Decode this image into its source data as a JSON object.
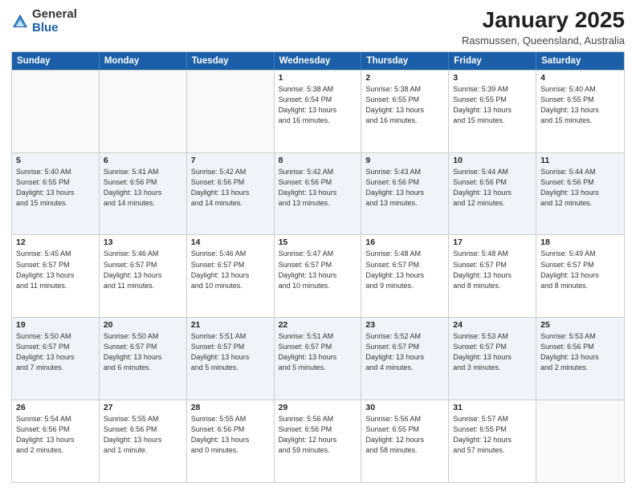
{
  "header": {
    "logo_general": "General",
    "logo_blue": "Blue",
    "month_title": "January 2025",
    "location": "Rasmussen, Queensland, Australia"
  },
  "weekdays": [
    "Sunday",
    "Monday",
    "Tuesday",
    "Wednesday",
    "Thursday",
    "Friday",
    "Saturday"
  ],
  "rows": [
    {
      "alt": false,
      "cells": [
        {
          "date": "",
          "info": ""
        },
        {
          "date": "",
          "info": ""
        },
        {
          "date": "",
          "info": ""
        },
        {
          "date": "1",
          "info": "Sunrise: 5:38 AM\nSunset: 6:54 PM\nDaylight: 13 hours\nand 16 minutes."
        },
        {
          "date": "2",
          "info": "Sunrise: 5:38 AM\nSunset: 6:55 PM\nDaylight: 13 hours\nand 16 minutes."
        },
        {
          "date": "3",
          "info": "Sunrise: 5:39 AM\nSunset: 6:55 PM\nDaylight: 13 hours\nand 15 minutes."
        },
        {
          "date": "4",
          "info": "Sunrise: 5:40 AM\nSunset: 6:55 PM\nDaylight: 13 hours\nand 15 minutes."
        }
      ]
    },
    {
      "alt": true,
      "cells": [
        {
          "date": "5",
          "info": "Sunrise: 5:40 AM\nSunset: 6:55 PM\nDaylight: 13 hours\nand 15 minutes."
        },
        {
          "date": "6",
          "info": "Sunrise: 5:41 AM\nSunset: 6:56 PM\nDaylight: 13 hours\nand 14 minutes."
        },
        {
          "date": "7",
          "info": "Sunrise: 5:42 AM\nSunset: 6:56 PM\nDaylight: 13 hours\nand 14 minutes."
        },
        {
          "date": "8",
          "info": "Sunrise: 5:42 AM\nSunset: 6:56 PM\nDaylight: 13 hours\nand 13 minutes."
        },
        {
          "date": "9",
          "info": "Sunrise: 5:43 AM\nSunset: 6:56 PM\nDaylight: 13 hours\nand 13 minutes."
        },
        {
          "date": "10",
          "info": "Sunrise: 5:44 AM\nSunset: 6:56 PM\nDaylight: 13 hours\nand 12 minutes."
        },
        {
          "date": "11",
          "info": "Sunrise: 5:44 AM\nSunset: 6:56 PM\nDaylight: 13 hours\nand 12 minutes."
        }
      ]
    },
    {
      "alt": false,
      "cells": [
        {
          "date": "12",
          "info": "Sunrise: 5:45 AM\nSunset: 6:57 PM\nDaylight: 13 hours\nand 11 minutes."
        },
        {
          "date": "13",
          "info": "Sunrise: 5:46 AM\nSunset: 6:57 PM\nDaylight: 13 hours\nand 11 minutes."
        },
        {
          "date": "14",
          "info": "Sunrise: 5:46 AM\nSunset: 6:57 PM\nDaylight: 13 hours\nand 10 minutes."
        },
        {
          "date": "15",
          "info": "Sunrise: 5:47 AM\nSunset: 6:57 PM\nDaylight: 13 hours\nand 10 minutes."
        },
        {
          "date": "16",
          "info": "Sunrise: 5:48 AM\nSunset: 6:57 PM\nDaylight: 13 hours\nand 9 minutes."
        },
        {
          "date": "17",
          "info": "Sunrise: 5:48 AM\nSunset: 6:57 PM\nDaylight: 13 hours\nand 8 minutes."
        },
        {
          "date": "18",
          "info": "Sunrise: 5:49 AM\nSunset: 6:57 PM\nDaylight: 13 hours\nand 8 minutes."
        }
      ]
    },
    {
      "alt": true,
      "cells": [
        {
          "date": "19",
          "info": "Sunrise: 5:50 AM\nSunset: 6:57 PM\nDaylight: 13 hours\nand 7 minutes."
        },
        {
          "date": "20",
          "info": "Sunrise: 5:50 AM\nSunset: 6:57 PM\nDaylight: 13 hours\nand 6 minutes."
        },
        {
          "date": "21",
          "info": "Sunrise: 5:51 AM\nSunset: 6:57 PM\nDaylight: 13 hours\nand 5 minutes."
        },
        {
          "date": "22",
          "info": "Sunrise: 5:51 AM\nSunset: 6:57 PM\nDaylight: 13 hours\nand 5 minutes."
        },
        {
          "date": "23",
          "info": "Sunrise: 5:52 AM\nSunset: 6:57 PM\nDaylight: 13 hours\nand 4 minutes."
        },
        {
          "date": "24",
          "info": "Sunrise: 5:53 AM\nSunset: 6:57 PM\nDaylight: 13 hours\nand 3 minutes."
        },
        {
          "date": "25",
          "info": "Sunrise: 5:53 AM\nSunset: 6:56 PM\nDaylight: 13 hours\nand 2 minutes."
        }
      ]
    },
    {
      "alt": false,
      "cells": [
        {
          "date": "26",
          "info": "Sunrise: 5:54 AM\nSunset: 6:56 PM\nDaylight: 13 hours\nand 2 minutes."
        },
        {
          "date": "27",
          "info": "Sunrise: 5:55 AM\nSunset: 6:56 PM\nDaylight: 13 hours\nand 1 minute."
        },
        {
          "date": "28",
          "info": "Sunrise: 5:55 AM\nSunset: 6:56 PM\nDaylight: 13 hours\nand 0 minutes."
        },
        {
          "date": "29",
          "info": "Sunrise: 5:56 AM\nSunset: 6:56 PM\nDaylight: 12 hours\nand 59 minutes."
        },
        {
          "date": "30",
          "info": "Sunrise: 5:56 AM\nSunset: 6:55 PM\nDaylight: 12 hours\nand 58 minutes."
        },
        {
          "date": "31",
          "info": "Sunrise: 5:57 AM\nSunset: 6:55 PM\nDaylight: 12 hours\nand 57 minutes."
        },
        {
          "date": "",
          "info": ""
        }
      ]
    }
  ]
}
